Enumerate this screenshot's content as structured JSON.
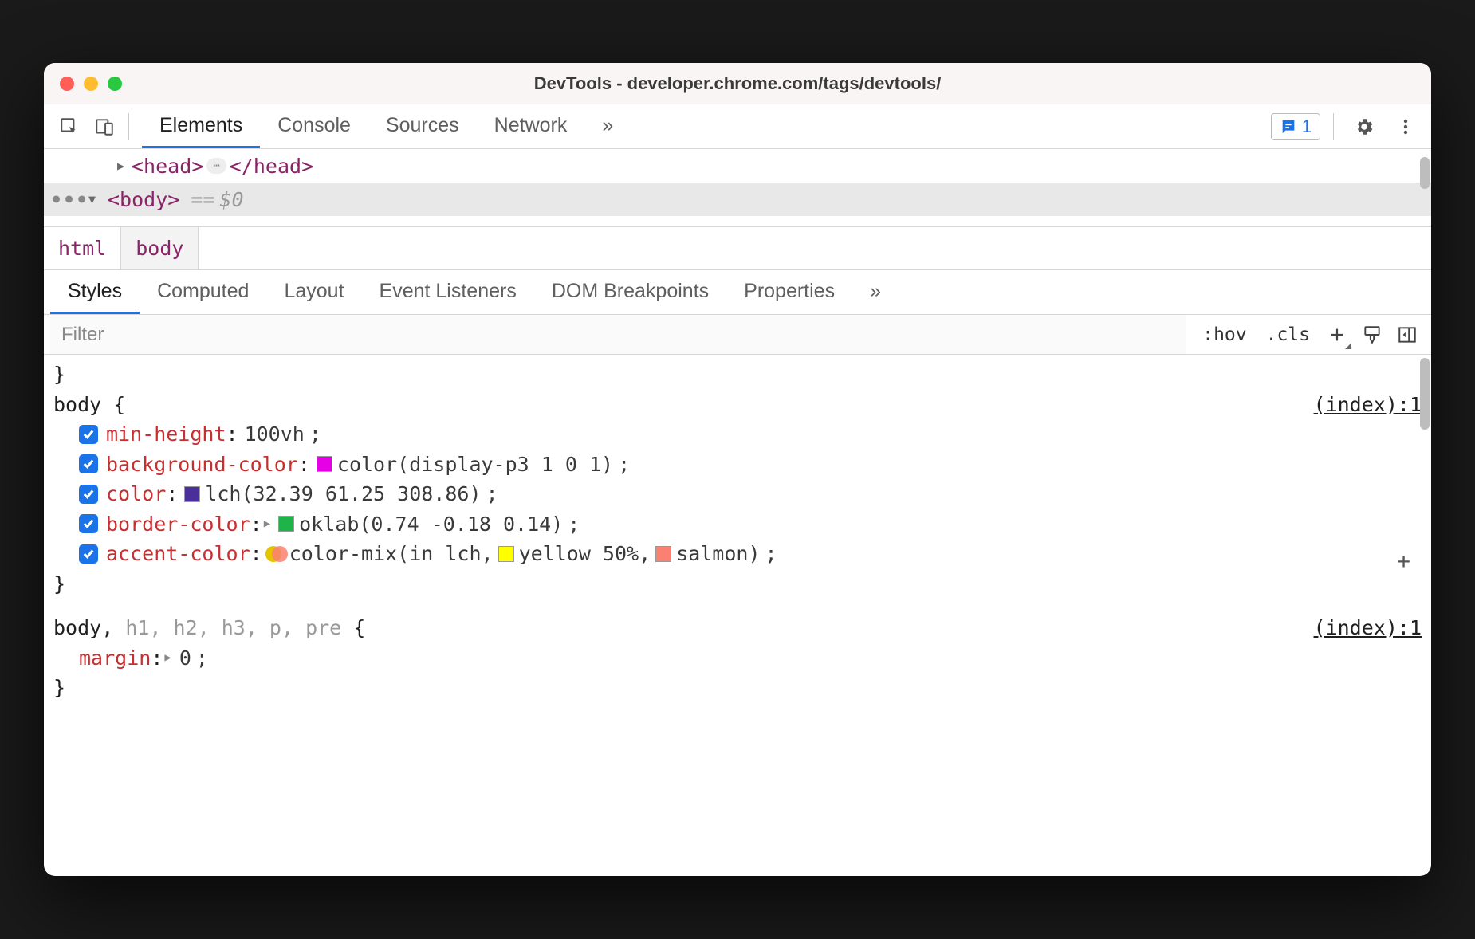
{
  "window": {
    "title": "DevTools - developer.chrome.com/tags/devtools/"
  },
  "toolbar": {
    "main_tabs": [
      "Elements",
      "Console",
      "Sources",
      "Network"
    ],
    "active_main_tab": 0,
    "overflow_glyph": "»",
    "issue_count": "1"
  },
  "dom": {
    "lines": [
      {
        "indent": true,
        "expander": "▶",
        "open": "<head>",
        "collapsed": "⋯",
        "close": "</head>",
        "selected": false
      },
      {
        "indent": false,
        "expander": "▼",
        "open": "<body>",
        "eq": "==",
        "dollar": "$0",
        "selected": true,
        "dots": "•••"
      }
    ]
  },
  "breadcrumb": {
    "items": [
      "html",
      "body"
    ],
    "active": 1
  },
  "sub_tabs": {
    "items": [
      "Styles",
      "Computed",
      "Layout",
      "Event Listeners",
      "DOM Breakpoints",
      "Properties"
    ],
    "active": 0,
    "overflow_glyph": "»"
  },
  "filter": {
    "placeholder": "Filter",
    "hov": ":hov",
    "cls": ".cls"
  },
  "styles": {
    "leading_brace": "}",
    "rules": [
      {
        "selector_html": "body",
        "source": "(index):1",
        "decls": [
          {
            "prop": "min-height",
            "value_parts": [
              {
                "text": "100vh"
              }
            ]
          },
          {
            "prop": "background-color",
            "value_parts": [
              {
                "swatch": "#e500e5"
              },
              {
                "text": "color(display-p3 1 0 1)"
              }
            ]
          },
          {
            "prop": "color",
            "value_parts": [
              {
                "swatch": "#4a2f9a"
              },
              {
                "text": "lch(32.39 61.25 308.86)"
              }
            ]
          },
          {
            "prop": "border-color",
            "expand": true,
            "value_parts": [
              {
                "swatch": "#1fb44a"
              },
              {
                "text": "oklab(0.74 -0.18 0.14)"
              }
            ]
          },
          {
            "prop": "accent-color",
            "value_parts": [
              {
                "mix": true
              },
              {
                "text": "color-mix(in lch, "
              },
              {
                "swatch": "#ffff00"
              },
              {
                "text": "yellow 50%, "
              },
              {
                "swatch": "#fa8072"
              },
              {
                "text": "salmon)"
              }
            ]
          }
        ],
        "show_add": true
      },
      {
        "selector_html": "body, <dim>h1, h2, h3, p, pre</dim>",
        "source": "(index):1",
        "decls": [
          {
            "prop": "margin",
            "expand": true,
            "nocheck": true,
            "value_parts": [
              {
                "text": "0"
              }
            ]
          }
        ],
        "open_only": true
      }
    ]
  }
}
